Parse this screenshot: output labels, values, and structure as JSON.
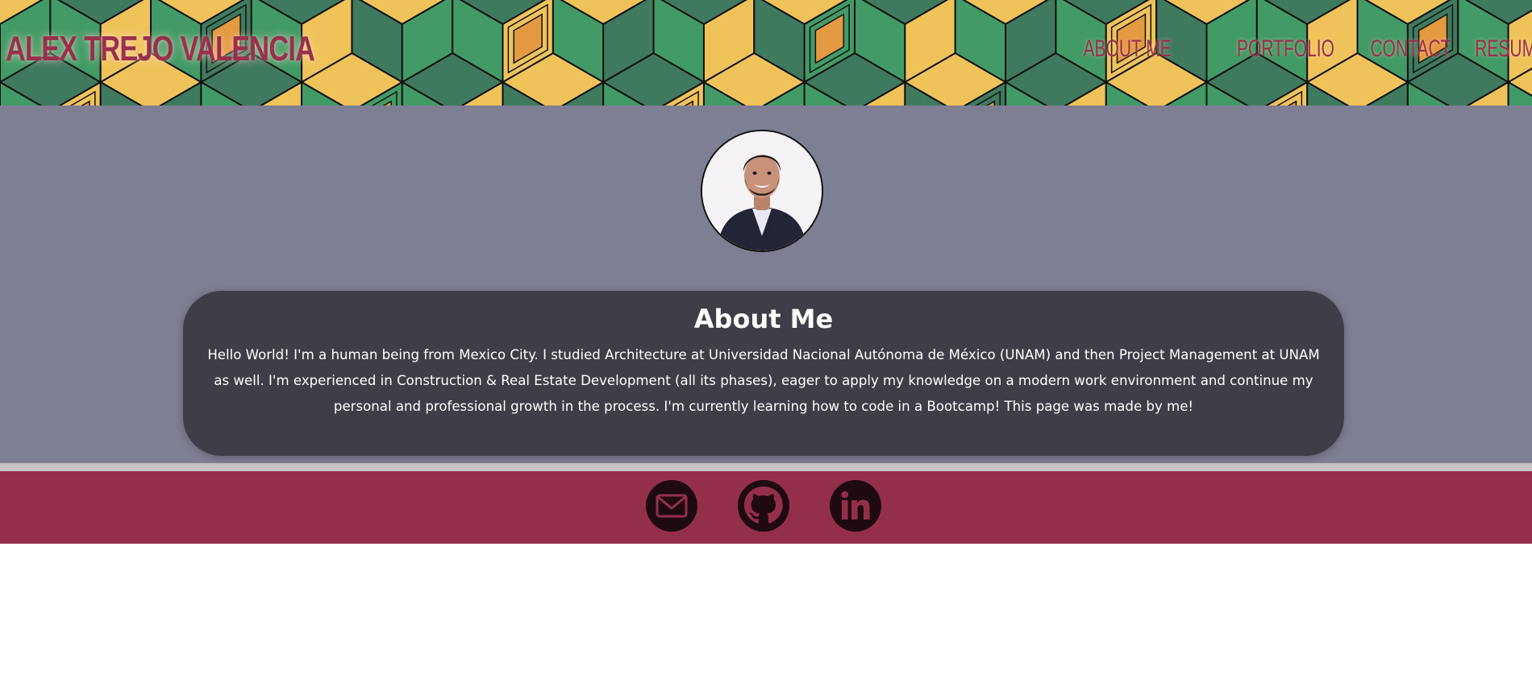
{
  "header": {
    "brand": "ALEX TREJO VALENCIA",
    "nav": [
      {
        "label": "ABOUT ME"
      },
      {
        "label": "PORTFOLIO"
      },
      {
        "label": "CONTACT"
      },
      {
        "label": "RESUME"
      }
    ],
    "pattern_colors": {
      "dark_green": "#3f7a5e",
      "green": "#429b66",
      "yellow": "#f0c35a",
      "orange": "#e39a40"
    },
    "text_color": "#9b2f4d"
  },
  "main": {
    "background": "#7f7f93",
    "avatar": {
      "icon": "profile-photo"
    },
    "about": {
      "title": "About Me",
      "text": "Hello World! I'm a human being from Mexico City. I studied Architecture at Universidad Nacional Autónoma de México (UNAM) and then Project Management at UNAM as well. I'm experienced in Construction & Real Estate Development (all its phases), eager to apply my knowledge on a modern work environment and continue my personal and professional growth in the process. I'm currently learning how to code in a Bootcamp! This page was made by me!"
    }
  },
  "footer": {
    "background": "#942f4b",
    "links": [
      {
        "icon": "mail-icon"
      },
      {
        "icon": "github-icon"
      },
      {
        "icon": "linkedin-icon"
      }
    ]
  }
}
